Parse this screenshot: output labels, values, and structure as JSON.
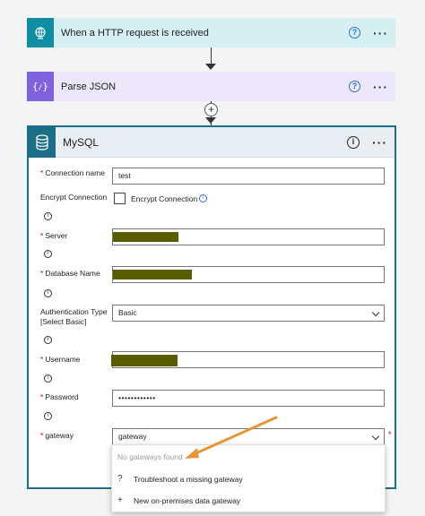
{
  "steps": [
    {
      "title": "When a HTTP request is received",
      "help": "?",
      "more": "···"
    },
    {
      "title": "Parse JSON",
      "help": "?",
      "more": "···"
    }
  ],
  "add_step_symbol": "+",
  "mysql": {
    "title": "MySQL",
    "info": "i",
    "more": "···",
    "fields": {
      "connection_name": {
        "label": "Connection name",
        "value": "test"
      },
      "encrypt_connection": {
        "label": "Encrypt Connection",
        "checkbox_label": "Encrypt Connection"
      },
      "server": {
        "label": "Server"
      },
      "database_name": {
        "label": "Database Name"
      },
      "authentication_type": {
        "label": "Authentication Type [Select Basic]",
        "value": "Basic"
      },
      "username": {
        "label": "Username"
      },
      "password": {
        "label": "Password",
        "value": "••••••••••••"
      },
      "gateway": {
        "label": "gateway",
        "value": "gateway"
      }
    },
    "required_mark": "*",
    "info_glyph": "i"
  },
  "gateway_dropdown": {
    "empty_text": "No gateways found",
    "items": [
      {
        "icon": "?",
        "label": "Troubleshoot a missing gateway"
      },
      {
        "icon": "+",
        "label": "New on-premises data gateway"
      }
    ]
  },
  "colors": {
    "http_accent": "#0f8ea3",
    "parse_accent": "#7f62de",
    "mysql_accent": "#1a6e86",
    "annotation_arrow": "#e8953a",
    "redaction": "#5a5c00"
  }
}
